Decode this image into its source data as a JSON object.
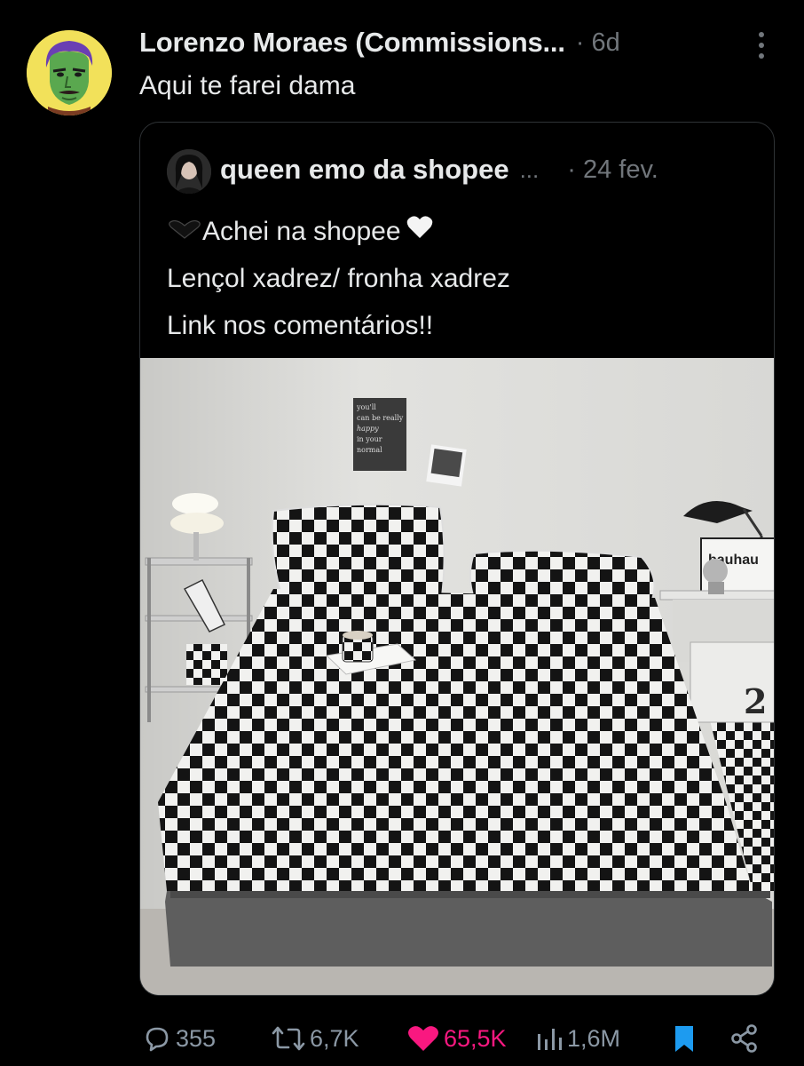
{
  "post": {
    "author_name": "Lorenzo Moraes (Commissions...",
    "time": "· 6d",
    "text": "Aqui te farei dama"
  },
  "quote": {
    "author_name": "queen emo da shopee",
    "ellipsis": "...",
    "time": "· 24 fev.",
    "lines": [
      "Achei na shopee",
      "Lençol xadrez/ fronha xadrez",
      "Link nos comentários!!"
    ],
    "image": {
      "poster_text": [
        "you'll",
        "can be really",
        "happy",
        "in your",
        "normal"
      ],
      "box_text": "bauhau",
      "box_number": "2"
    }
  },
  "actions": {
    "replies": "355",
    "reposts": "6,7K",
    "likes": "65,5K",
    "views": "1,6M"
  },
  "colors": {
    "background": "#000000",
    "text": "#e7e9ea",
    "muted": "#71767b",
    "like": "#f91880",
    "bookmark": "#1d9bf0",
    "border": "#2f3336"
  }
}
